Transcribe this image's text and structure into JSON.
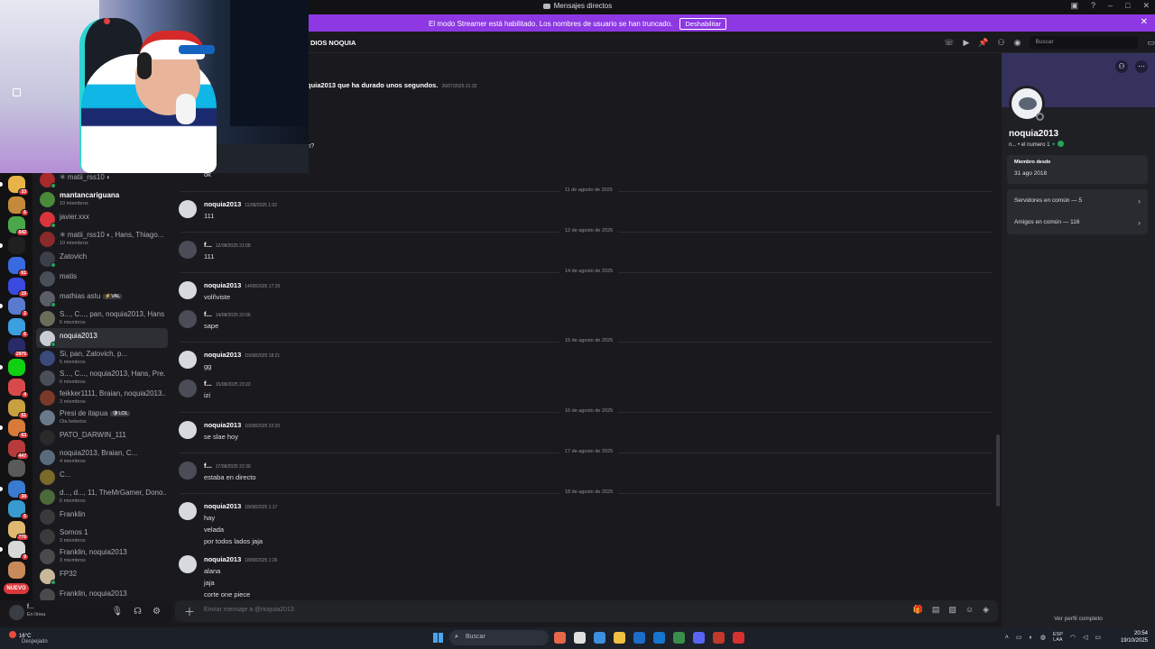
{
  "window": {
    "title": "Mensajes directos"
  },
  "banner": {
    "text": "El modo Streamer está habilitado. Los nombres de usuario se han truncado.",
    "button": "Deshabilitar"
  },
  "rail": {
    "new_badge": "NUEVO",
    "badges": [
      "33",
      "6",
      "642",
      "",
      "61",
      "19",
      "2",
      "6",
      "2975",
      "",
      "4",
      "51",
      "63",
      "447",
      "",
      "34",
      "5",
      "776",
      "9",
      ""
    ]
  },
  "dm_list": [
    {
      "name": "✳ matii_rss10 ◐",
      "sub": "",
      "color": "#a82a2a"
    },
    {
      "name": "mantancariguana",
      "sub": "10 miembros",
      "color": "#4a8a3a",
      "bright": true
    },
    {
      "name": "javier.xxx",
      "sub": "",
      "color": "#d9353b"
    },
    {
      "name": "✳ matii_rss10 ◐, Hans, Thiago...",
      "sub": "10 miembros",
      "color": "#8a2a2a"
    },
    {
      "name": "Zatovich",
      "sub": "",
      "color": "#3a3f4a"
    },
    {
      "name": "matis",
      "sub": "",
      "color": "#4a4e58"
    },
    {
      "name": "mathias astu",
      "tag": "⚡VAL",
      "sub": "",
      "color": "#5a5e68"
    },
    {
      "name": "S..., C..., pan, noquia2013, Hans",
      "sub": "6 miembros",
      "color": "#6a6e58"
    },
    {
      "name": "noquia2013",
      "sub": "",
      "color": "#c8ccd4",
      "active": true
    },
    {
      "name": "Si, pan, Zatovich, p...",
      "sub": "5 miembros",
      "color": "#3a4a7a"
    },
    {
      "name": "S..., C..., noquia2013, Hans, Pre...",
      "sub": "6 miembros",
      "color": "#4a4e58"
    },
    {
      "name": "feikker1111, Braian, noquia2013...",
      "sub": "3 miembros",
      "color": "#7a3a2a"
    },
    {
      "name": "Presi de itapua",
      "tag": "🛡LOL",
      "sub": "Ola bebetos",
      "color": "#6a7a8a"
    },
    {
      "name": "PATO_DARWIN_111",
      "sub": "",
      "color": "#2a2a2a"
    },
    {
      "name": "noquia2013, Braian, C...",
      "sub": "4 miembros",
      "color": "#5a6a7a"
    },
    {
      "name": "C...",
      "sub": "",
      "color": "#7a6a2a"
    },
    {
      "name": "d..., d..., 11, TheMrGamer, Dono...",
      "sub": "6 miembros",
      "color": "#4a6a3a"
    },
    {
      "name": "Franklin",
      "sub": "",
      "color": "#3a3a3a"
    },
    {
      "name": "Somos 1",
      "sub": "3 miembros",
      "color": "#3a3a3a"
    },
    {
      "name": "Franklin, noquia2013",
      "sub": "3 miembros",
      "color": "#4a4a4a"
    },
    {
      "name": "FP32",
      "sub": "",
      "color": "#c8b89a"
    },
    {
      "name": "Franklin, noquia2013",
      "sub": "",
      "color": "#4a4a4a"
    }
  ],
  "user_panel": {
    "name": "f...",
    "status": "En línea"
  },
  "chat": {
    "channel": "DIOS NOQUIA",
    "search_placeholder": "Buscar",
    "top_partial": "quia2013 que ha durado unos segundos.",
    "top_partial_time": "26/07/2025 21:32",
    "partial_1": "n?",
    "partial_2": "ok",
    "days": [
      "11 de agosto de 2025",
      "12 de agosto de 2025",
      "14 de agosto de 2025",
      "15 de agosto de 2025",
      "16 de agosto de 2025",
      "17 de agosto de 2025",
      "18 de agosto de 2025"
    ],
    "messages": [
      {
        "author": "noquia2013",
        "time": "11/08/2025 1:02",
        "lines": [
          "111"
        ]
      },
      {
        "author": "f...",
        "time": "12/08/2025 21:08",
        "lines": [
          "111"
        ]
      },
      {
        "author": "noquia2013",
        "time": "14/08/2025 17:29",
        "lines": [
          "volñviste"
        ]
      },
      {
        "author": "f...",
        "time": "14/08/2025 22:06",
        "lines": [
          "sape"
        ]
      },
      {
        "author": "noquia2013",
        "time": "15/08/2025 18:21",
        "lines": [
          "gg"
        ]
      },
      {
        "author": "f...",
        "time": "15/08/2025 23:22",
        "lines": [
          "izi"
        ]
      },
      {
        "author": "noquia2013",
        "time": "16/08/2025 22:20",
        "lines": [
          "se slae hoy"
        ]
      },
      {
        "author": "f...",
        "time": "17/08/2025 22:30",
        "lines": [
          "estaba en directo"
        ]
      },
      {
        "author": "noquia2013",
        "time": "18/08/2025 1:17",
        "lines": [
          "hay",
          "velada",
          "por todos lados jaja"
        ]
      },
      {
        "author": "noquia2013",
        "time": "18/08/2025 1:26",
        "lines": [
          "alana",
          "jaja",
          "corte one piece"
        ]
      }
    ],
    "composer_placeholder": "Enviar mensaje a @noquia2013"
  },
  "profile": {
    "name": "noquia2013",
    "tagline": "n... • el numero 1",
    "member_since_label": "Miembro desde",
    "member_since": "31 ago 2018",
    "mutual_servers": "Servidores en común — 5",
    "mutual_friends": "Amigos en común — 116",
    "view_full": "Ver perfil completo"
  },
  "taskbar": {
    "temp": "16°C",
    "weather": "Despejado",
    "search": "Buscar",
    "lang1": "ESP",
    "lang2": "LAA",
    "time": "20:54",
    "date": "19/10/2025"
  }
}
